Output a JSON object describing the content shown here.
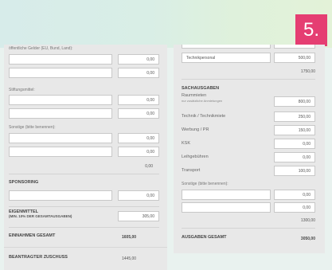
{
  "step": "5.",
  "income": {
    "public_label": "öffentliche Gelder (EU, Bund, Land):",
    "public_values": [
      "0,00",
      "0,00"
    ],
    "foundation_label": "Stiftungsmittel:",
    "foundation_values": [
      "0,00",
      "0,00"
    ],
    "other_label": "Sonstige (bitte benennen):",
    "other_values": [
      "0,00",
      "0,00"
    ],
    "other_subtotal": "0,00",
    "sponsoring_label": "SPONSORING",
    "sponsoring_value": "0,00",
    "own_funds_label": "EIGENMITTEL",
    "own_funds_sub": "(MIN. 10% DER GESAMTAUSGABEN)",
    "own_funds_value": "305,00",
    "total_label": "EINNAHMEN GESAMT",
    "total_value": "1605,00",
    "grant_label": "BEANTRAGTER ZUSCHUSS",
    "grant_value": "1445,00"
  },
  "expenses": {
    "technician_label": "Technikpersonal",
    "technician_value": "500,00",
    "personnel_subtotal": "1750,00",
    "material_header": "SACHAUSGABEN",
    "rows": [
      {
        "label": "Raummieten",
        "note": "nur zusätzliche Anmietungen",
        "value": "800,00"
      },
      {
        "label": "Technik / Technikmiete",
        "note": "",
        "value": "250,00"
      },
      {
        "label": "Werbung / PR",
        "note": "",
        "value": "150,00"
      },
      {
        "label": "KSK",
        "note": "",
        "value": "0,00"
      },
      {
        "label": "Leihgebühren",
        "note": "",
        "value": "0,00"
      },
      {
        "label": "Transport",
        "note": "",
        "value": "100,00"
      }
    ],
    "other_label": "Sonstige (bitte benennen):",
    "other_values": [
      "0,00",
      "0,00"
    ],
    "material_subtotal": "1300,00",
    "total_label": "AUSGABEN GESAMT",
    "total_value": "3050,00"
  }
}
